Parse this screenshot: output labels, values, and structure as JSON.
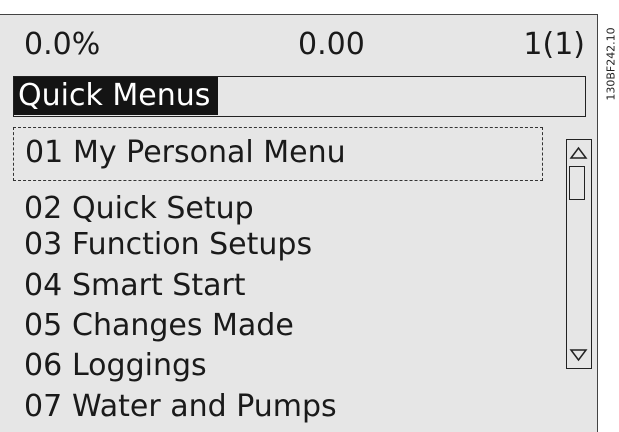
{
  "status": {
    "left": "0.0%",
    "middle": "0.00",
    "right": "1(1)"
  },
  "title": "Quick Menus",
  "menu": [
    {
      "num": "01",
      "label": "My Personal Menu",
      "selected": true
    },
    {
      "num": "02",
      "label": "Quick Setup"
    },
    {
      "num": "03",
      "label": "Function Setups"
    },
    {
      "num": "04",
      "label": "Smart Start"
    },
    {
      "num": "05",
      "label": "Changes Made"
    },
    {
      "num": "06",
      "label": "Loggings"
    },
    {
      "num": "07",
      "label": "Water and Pumps"
    }
  ],
  "scrollbar": {
    "up_icon": "triangle-up",
    "down_icon": "triangle-down"
  },
  "figure_code": "130BF242.10"
}
